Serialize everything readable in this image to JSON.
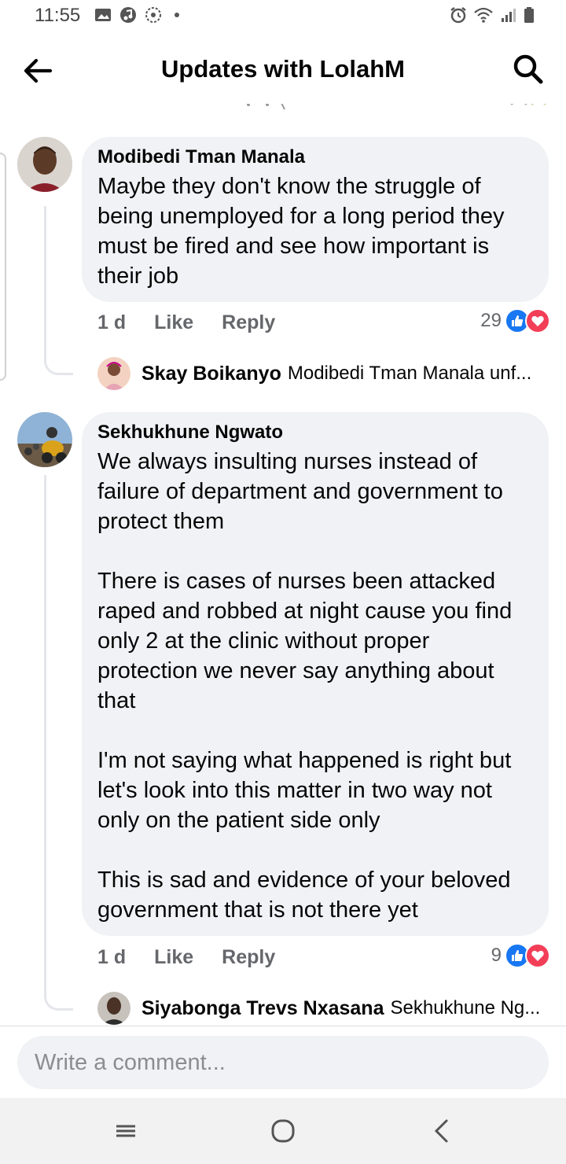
{
  "status_bar": {
    "time": "11:55",
    "left_icons": [
      "gallery-icon",
      "music-icon",
      "settings-sync-icon",
      "dot-icon"
    ],
    "right_icons": [
      "alarm-icon",
      "wifi-icon",
      "signal-icon",
      "battery-icon"
    ]
  },
  "header": {
    "title": "Updates with LolahM",
    "back_icon": "arrow-left-icon",
    "search_icon": "search-icon"
  },
  "comments": [
    {
      "author": "Modibedi Tman Manala",
      "text": "Maybe they don't know the struggle of being unemployed for a long period they must be fired and see how important is their job",
      "time": "1 d",
      "like_label": "Like",
      "reply_label": "Reply",
      "reaction_count": "29",
      "reactions": [
        "thumbs-up-icon",
        "heart-icon"
      ],
      "reply": {
        "author": "Skay Boikanyo",
        "preview": "Modibedi Tman Manala unf..."
      }
    },
    {
      "author": "Sekhukhune Ngwato",
      "text": "We always insulting nurses instead of failure of department and government to protect them\n\nThere is cases of nurses been attacked raped and robbed at night cause you find only 2 at the clinic without proper protection we never say anything about that\n\nI'm not saying what happened is right but let's look into this matter in two way not only on the patient side only\n\nThis is sad and evidence of your beloved government that is not there yet",
      "time": "1 d",
      "like_label": "Like",
      "reply_label": "Reply",
      "reaction_count": "9",
      "reactions": [
        "thumbs-up-icon",
        "heart-icon"
      ],
      "reply": {
        "author": "Siyabonga Trevs Nxasana",
        "preview": "Sekhukhune Ng..."
      }
    }
  ],
  "composer": {
    "placeholder": "Write a comment..."
  },
  "nav_bar": {
    "buttons": [
      "recent-apps-icon",
      "home-icon",
      "back-chevron-icon"
    ]
  },
  "colors": {
    "like_blue": "#1877f2",
    "heart_red": "#f33e58",
    "bubble": "#f0f2f5",
    "secondary_text": "#65676b"
  }
}
